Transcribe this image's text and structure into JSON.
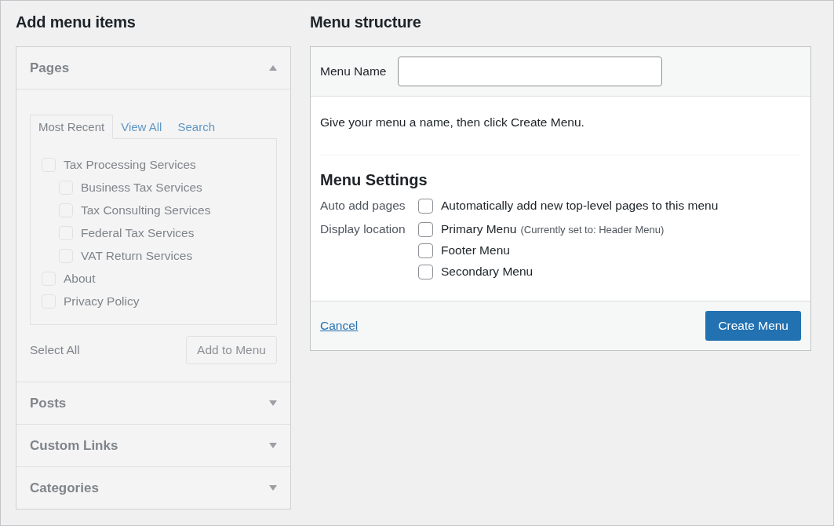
{
  "add_menu_items": {
    "title": "Add menu items",
    "disabled": true,
    "sections": [
      {
        "title": "Pages",
        "expanded": true,
        "tabs": [
          {
            "label": "Most Recent",
            "selected": true
          },
          {
            "label": "View All",
            "selected": false
          },
          {
            "label": "Search",
            "selected": false
          }
        ],
        "items": [
          {
            "label": "Tax Processing Services",
            "checked": false,
            "children": [
              {
                "label": "Business Tax Services",
                "checked": false
              },
              {
                "label": "Tax Consulting Services",
                "checked": false
              },
              {
                "label": "Federal Tax Services",
                "checked": false
              },
              {
                "label": "VAT Return Services",
                "checked": false
              }
            ]
          },
          {
            "label": "About",
            "checked": false
          },
          {
            "label": "Privacy Policy",
            "checked": false
          }
        ],
        "select_all": "Select All",
        "add_button": "Add to Menu"
      },
      {
        "title": "Posts",
        "expanded": false
      },
      {
        "title": "Custom Links",
        "expanded": false
      },
      {
        "title": "Categories",
        "expanded": false
      }
    ]
  },
  "menu_structure": {
    "title": "Menu structure",
    "menu_name": {
      "label": "Menu Name"
    },
    "instruction": "Give your menu a name, then click Create Menu.",
    "settings_title": "Menu Settings",
    "settings": [
      {
        "label": "Auto add pages",
        "options": [
          {
            "label": "Automatically add new top-level pages to this menu",
            "checked": false
          }
        ]
      },
      {
        "label": "Display location",
        "options": [
          {
            "label": "Primary Menu",
            "note": "(Currently set to: Header Menu)",
            "checked": false
          },
          {
            "label": "Footer Menu",
            "checked": false
          },
          {
            "label": "Secondary Menu",
            "checked": false
          }
        ]
      }
    ],
    "cancel": "Cancel",
    "create_button": "Create Menu"
  }
}
